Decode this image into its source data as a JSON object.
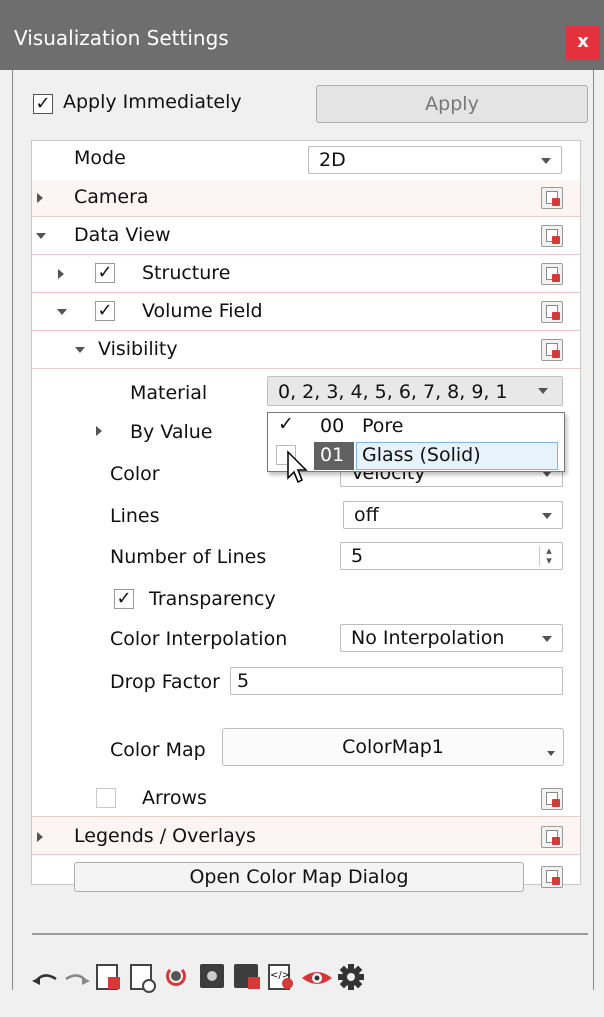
{
  "window": {
    "title": "Visualization Settings",
    "close_label": "x"
  },
  "top": {
    "apply_immediately_label": "Apply Immediately",
    "apply_immediately_checked": true,
    "apply_label": "Apply"
  },
  "tree": {
    "mode": {
      "label": "Mode",
      "value": "2D"
    },
    "camera": {
      "label": "Camera"
    },
    "data_view": {
      "label": "Data View"
    },
    "structure": {
      "label": "Structure",
      "checked": true
    },
    "volume_field": {
      "label": "Volume Field",
      "checked": true
    },
    "visibility": {
      "label": "Visibility"
    },
    "material": {
      "label": "Material",
      "value": "0, 2, 3, 4, 5, 6, 7, 8, 9, 1"
    },
    "by_value": {
      "label": "By Value"
    },
    "color": {
      "label": "Color",
      "value": "Velocity"
    },
    "lines": {
      "label": "Lines",
      "value": "off"
    },
    "number_of_lines": {
      "label": "Number of Lines",
      "value": "5"
    },
    "transparency": {
      "label": "Transparency",
      "checked": true
    },
    "color_interpolation": {
      "label": "Color Interpolation",
      "value": "No Interpolation"
    },
    "drop_factor": {
      "label": "Drop Factor",
      "value": "5"
    },
    "color_map": {
      "label": "Color Map",
      "value": "ColorMap1"
    },
    "arrows": {
      "label": "Arrows",
      "checked": false
    },
    "legends": {
      "label": "Legends / Overlays"
    },
    "open_color_map": {
      "label": "Open Color Map Dialog"
    }
  },
  "material_popup": {
    "items": [
      {
        "id": "00",
        "name": "Pore",
        "checked": true
      },
      {
        "id": "01",
        "name": "Glass (Solid)",
        "checked": false
      }
    ]
  },
  "toolbar": {
    "icons": [
      "undo-icon",
      "redo-icon",
      "reset-document-icon",
      "settings-document-icon",
      "refresh-icon",
      "dark-settings-icon",
      "dark-reset-icon",
      "code-document-icon",
      "eye-icon",
      "gear-icon"
    ]
  },
  "colors": {
    "titlebar": "#6e6e6e",
    "close": "#e3323b",
    "row_separator": "#f0c8c8",
    "highlight": "#616161"
  }
}
